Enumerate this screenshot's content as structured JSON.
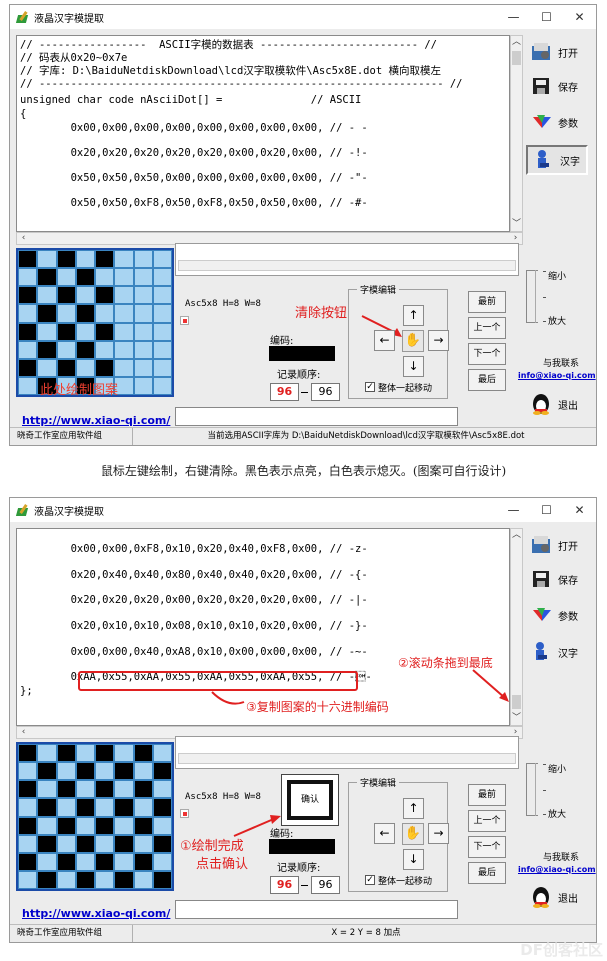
{
  "window1": {
    "title": "液晶汉字模提取",
    "controls": {
      "minimize": "—",
      "maximize": "☐",
      "close": "✕"
    },
    "code_lines": [
      "// -----------------  ASCII字模的数据表 ------------------------- //",
      "// 码表从0x20~0x7e",
      "// 字库: D:\\BaiduNetdiskDownload\\lcd汉字取模软件\\Asc5x8E.dot 横向取模左",
      "// ---------------------------------------------------------------- //",
      "unsigned char code nAsciiDot[] =              // ASCII",
      "{",
      "        0x00,0x00,0x00,0x00,0x00,0x00,0x00,0x00, // - -",
      "        0x20,0x20,0x20,0x20,0x20,0x00,0x20,0x00, // -!-",
      "        0x50,0x50,0x50,0x00,0x00,0x00,0x00,0x00, // -\"-",
      "        0x50,0x50,0xF8,0x50,0xF8,0x50,0x50,0x00, // -#-"
    ],
    "font_info": "Asc5x8 H=8 W=8",
    "code_label": "编码:",
    "record_label": "记录顺序:",
    "record_current": "96",
    "record_total": "96",
    "group_title": "字模编辑",
    "move_all_label": "整体一起移动",
    "url": "http://www.xiao-qi.com/",
    "status_left": "晓奇工作室应用软件组",
    "status_right": "当前选用ASCII字库为 D:\\BaiduNetdiskDownload\\lcd汉字取模软件\\Asc5x8E.dot",
    "annot_clear": "清除按钮",
    "annot_draw": "此处绘制图案"
  },
  "caption": "鼠标左键绘制，右键清除。黑色表示点亮，白色表示熄灭。(图案可自行设计)",
  "window2": {
    "title": "液晶汉字模提取",
    "controls": {
      "minimize": "—",
      "maximize": "☐",
      "close": "✕"
    },
    "code_lines": [
      "        0x00,0x00,0xF8,0x10,0x20,0x40,0xF8,0x00, // -z-",
      "        0x20,0x40,0x40,0x80,0x40,0x40,0x20,0x00, // -{-",
      "        0x20,0x20,0x20,0x00,0x20,0x20,0x20,0x00, // -|-",
      "        0x20,0x10,0x10,0x08,0x10,0x10,0x20,0x00, // -}-",
      "        0x00,0x00,0x40,0xA8,0x10,0x00,0x00,0x00, // -~-",
      "        0xAA,0x55,0xAA,0x55,0xAA,0x55,0xAA,0x55, // -\u0001-",
      "};"
    ],
    "font_info": "Asc5x8 H=8 W=8",
    "confirm_label": "确认",
    "code_label": "编码:",
    "record_label": "记录顺序:",
    "record_current": "96",
    "record_total": "96",
    "group_title": "字模编辑",
    "move_all_label": "整体一起移动",
    "url": "http://www.xiao-qi.com/",
    "status_left": "晓奇工作室应用软件组",
    "status_right": "X = 2 Y = 8 加点",
    "annot_scroll": "②滚动条拖到最底",
    "annot_copy": "③复制图案的十六进制编码",
    "annot_done_1": "①绘制完成",
    "annot_done_2": "点击确认"
  },
  "sidebar": {
    "open": "打开",
    "save": "保存",
    "params": "参数",
    "hanzi": "汉字",
    "zoom_out": "缩小",
    "zoom_in": "放大",
    "contact": "与我联系",
    "email": "info@xiao-qi.com",
    "exit": "退出"
  },
  "nav": {
    "first": "最前",
    "prev": "上一个",
    "next": "下一个",
    "last": "最后"
  },
  "arrows": {
    "up": "↑",
    "down": "↓",
    "left": "←",
    "right": "→",
    "center": "✋"
  },
  "pattern": [
    [
      1,
      0,
      1,
      0,
      1,
      0,
      1,
      0
    ],
    [
      0,
      1,
      0,
      1,
      0,
      1,
      0,
      1
    ],
    [
      1,
      0,
      1,
      0,
      1,
      0,
      1,
      0
    ],
    [
      0,
      1,
      0,
      1,
      0,
      1,
      0,
      1
    ],
    [
      1,
      0,
      1,
      0,
      1,
      0,
      1,
      0
    ],
    [
      0,
      1,
      0,
      1,
      0,
      1,
      0,
      1
    ],
    [
      1,
      0,
      1,
      0,
      1,
      0,
      1,
      0
    ],
    [
      0,
      1,
      0,
      1,
      0,
      1,
      0,
      1
    ]
  ],
  "watermark": "DF创客社区",
  "colors": {
    "annotation": "#e02020",
    "link": "#0000cc",
    "grid_border": "#1b4ba8"
  }
}
